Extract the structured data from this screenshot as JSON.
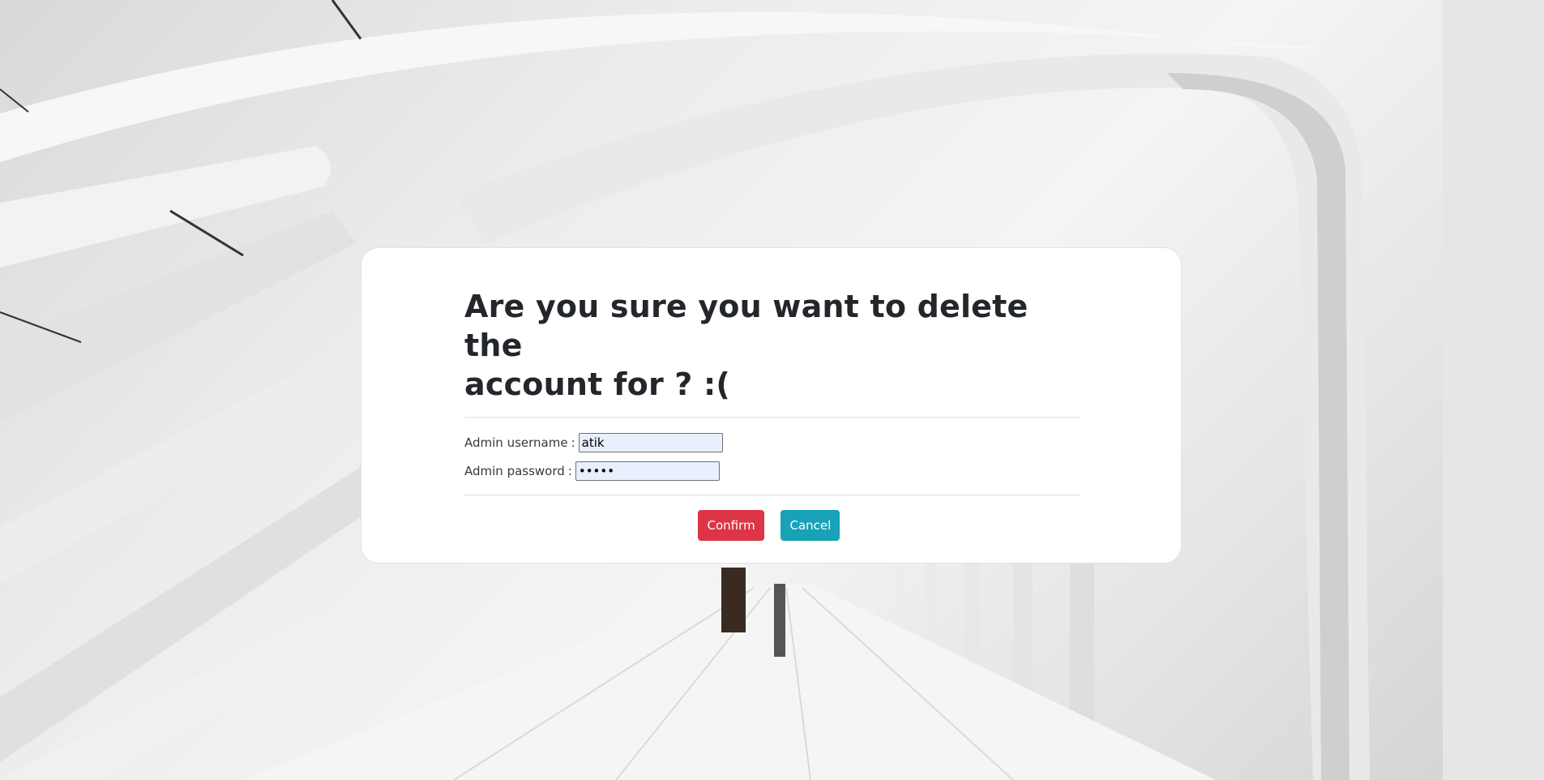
{
  "dialog": {
    "title_line1": "Are you sure you want to delete the",
    "title_line2": "account for ? :(",
    "username_label": "Admin username",
    "password_label": "Admin password",
    "label_separator": ":",
    "username_value": "atik",
    "password_mask": "•••••",
    "confirm_label": "Confirm",
    "cancel_label": "Cancel"
  },
  "colors": {
    "confirm": "#dc3545",
    "cancel": "#17a2b8",
    "input_bg": "#e8f0fe"
  }
}
